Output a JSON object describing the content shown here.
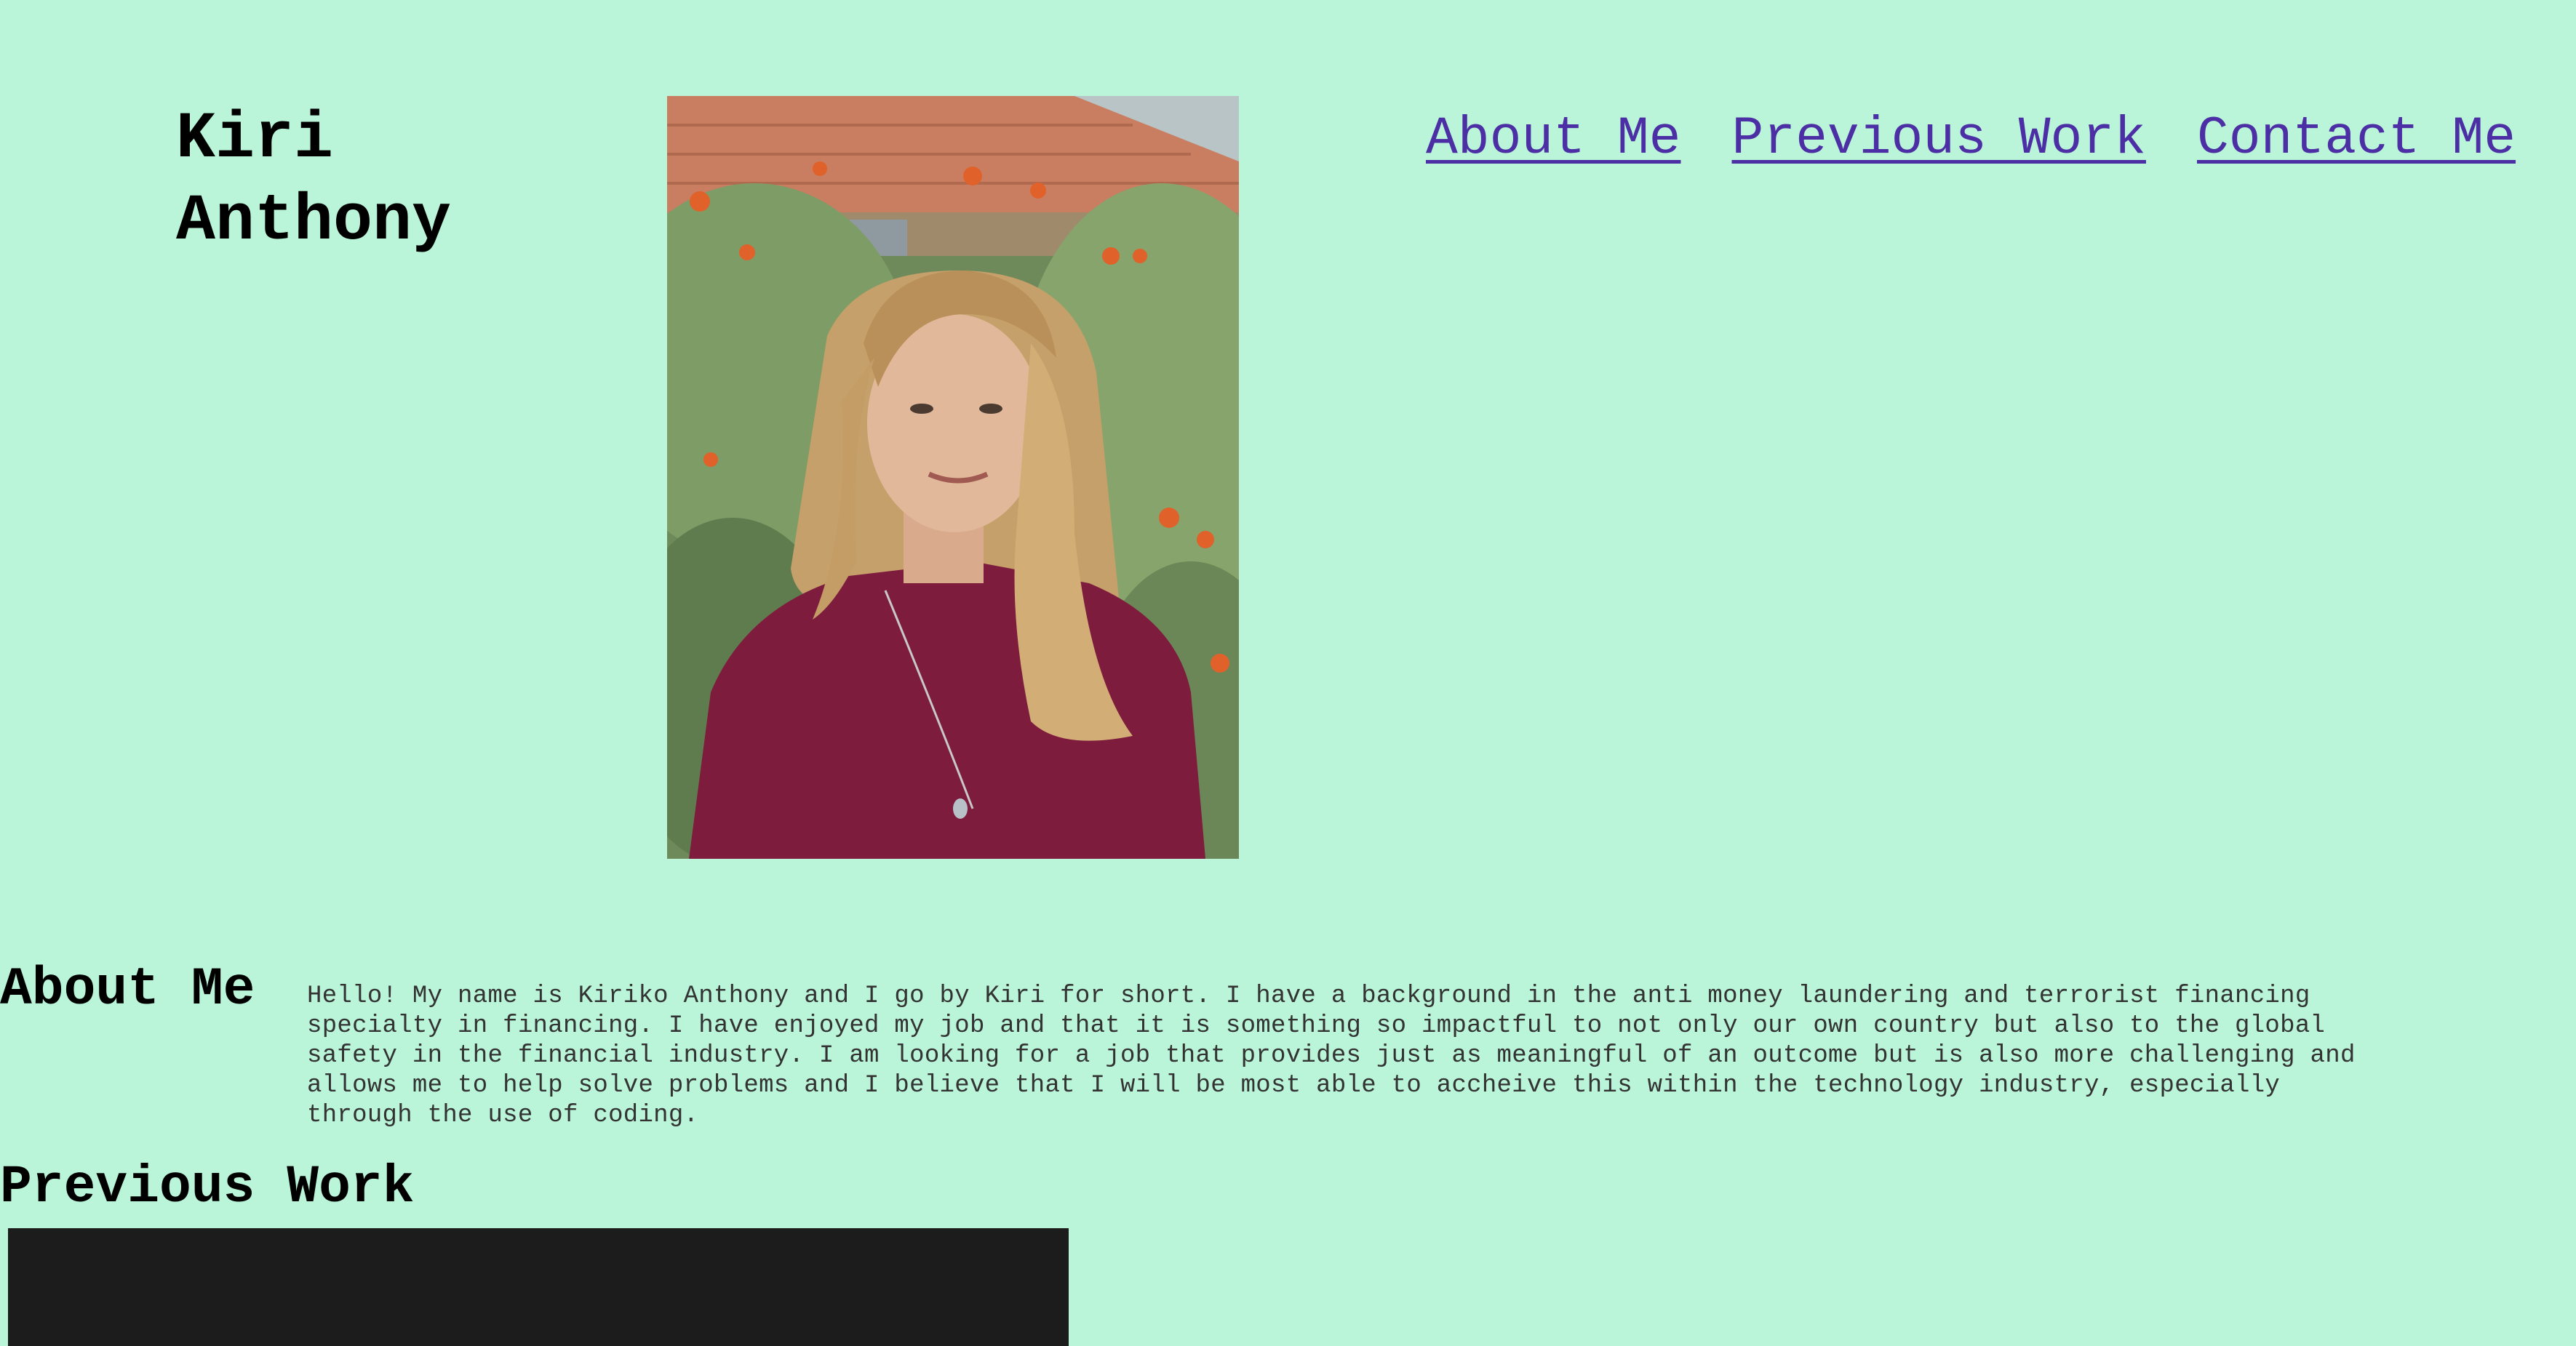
{
  "header": {
    "name_line1": "Kiri",
    "name_line2": "Anthony"
  },
  "portrait": {
    "alt": "Kiri Anthony portrait"
  },
  "nav": {
    "about": "About Me",
    "work": "Previous Work",
    "contact": "Contact Me"
  },
  "about": {
    "heading": "About Me",
    "text": "Hello! My name is Kiriko Anthony and I go by Kiri for short. I have a background in the anti money laundering and terrorist financing specialty in financing. I have enjoyed my job and that it is something so impactful to not only our own country but also to the global safety in the financial industry. I am looking for a job that provides just as meaningful of an outcome but is also more challenging and allows me to help solve problems and I believe that I will be most able to accheive this within the technology industry, especially through the use of coding."
  },
  "work": {
    "heading": "Previous Work"
  },
  "colors": {
    "background": "#baf5d9",
    "link": "#4c2fa5",
    "heading": "#000000",
    "body_text": "#333333",
    "work_preview": "#1c1c1c"
  }
}
